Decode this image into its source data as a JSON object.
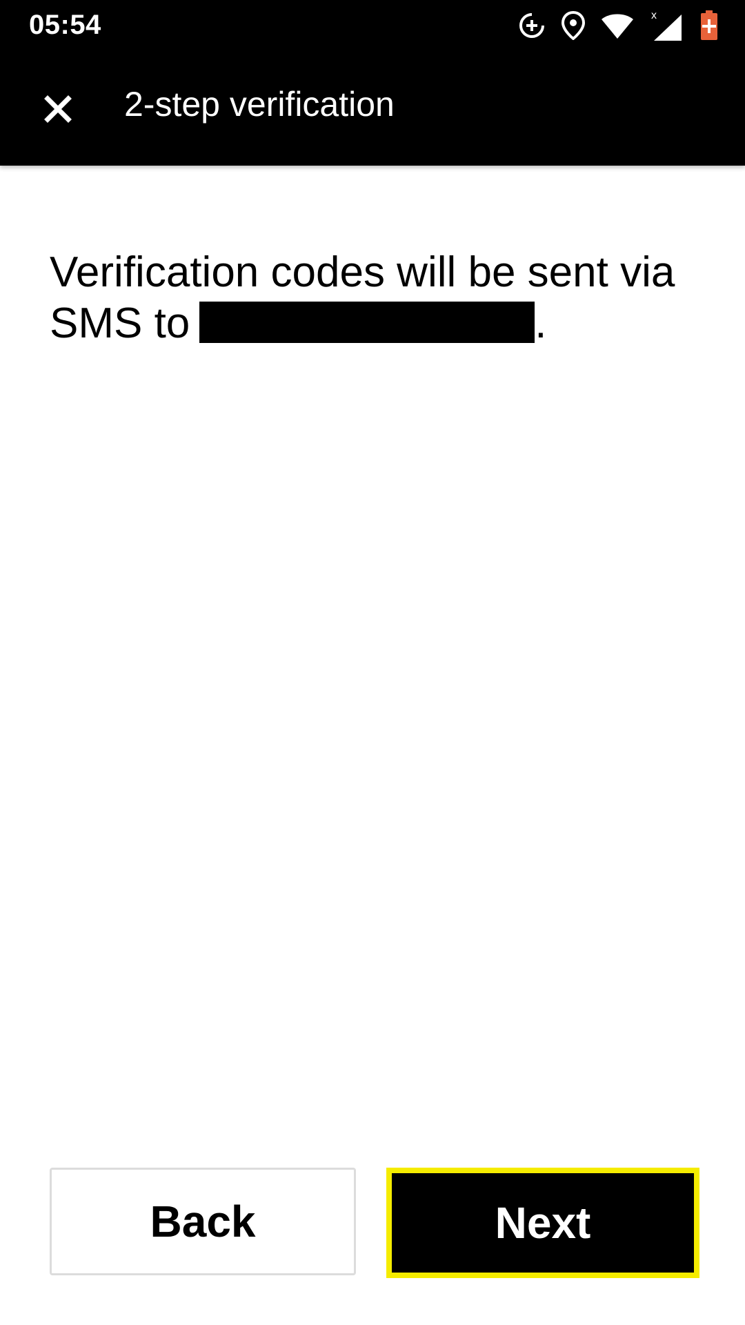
{
  "status_bar": {
    "time": "05:54",
    "icons": [
      "data-saver-icon",
      "location-icon",
      "wifi-icon",
      "cell-signal-icon",
      "battery-charging-icon"
    ],
    "battery_color": "#e8623a"
  },
  "app_bar": {
    "title": "2-step verification",
    "close_icon": "close-icon"
  },
  "content": {
    "message_prefix": "Verification codes will be sent via SMS to",
    "message_suffix": "."
  },
  "buttons": {
    "back_label": "Back",
    "next_label": "Next"
  },
  "colors": {
    "header_bg": "#000000",
    "next_focus_border": "#f5ec00",
    "back_border": "#dcdcdc"
  }
}
